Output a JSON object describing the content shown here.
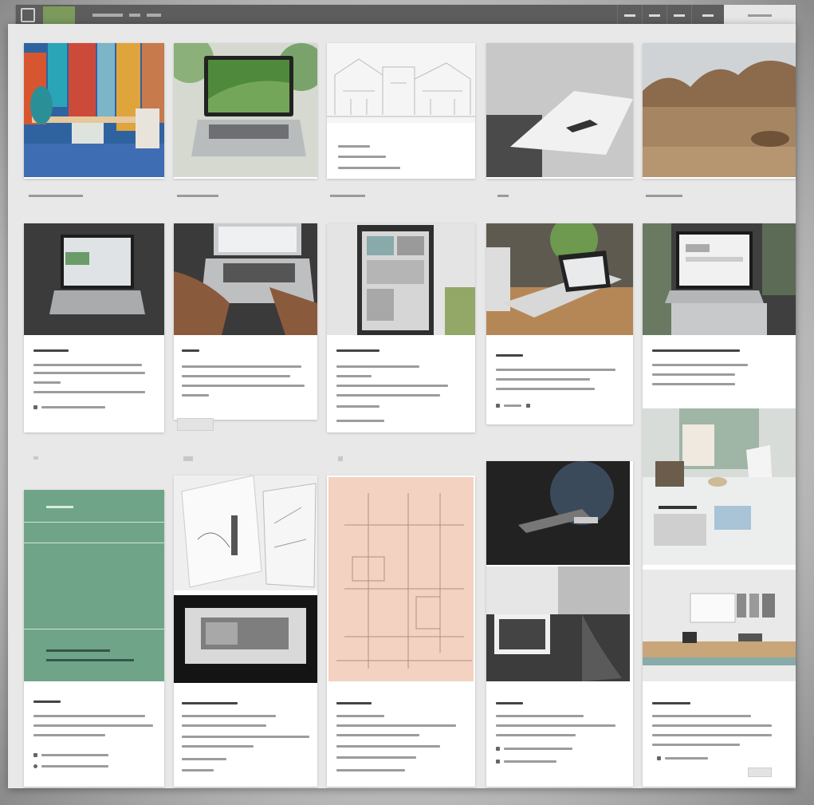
{
  "header": {
    "nav": [
      "",
      "",
      ""
    ],
    "right_tabs": [
      "",
      "",
      "",
      ""
    ]
  },
  "cards": [
    {
      "title": ""
    },
    {
      "title": ""
    },
    {
      "title": ""
    },
    {
      "title": ""
    },
    {
      "title": ""
    },
    {
      "title": ""
    },
    {
      "title": ""
    },
    {
      "title": ""
    },
    {
      "title": ""
    },
    {
      "title": ""
    }
  ],
  "colors": {
    "topbar": "#5d5d5d",
    "brand_accent": "#7b9a5c",
    "mint_card": "#6fa387",
    "peach_card": "#f2cfbd"
  }
}
